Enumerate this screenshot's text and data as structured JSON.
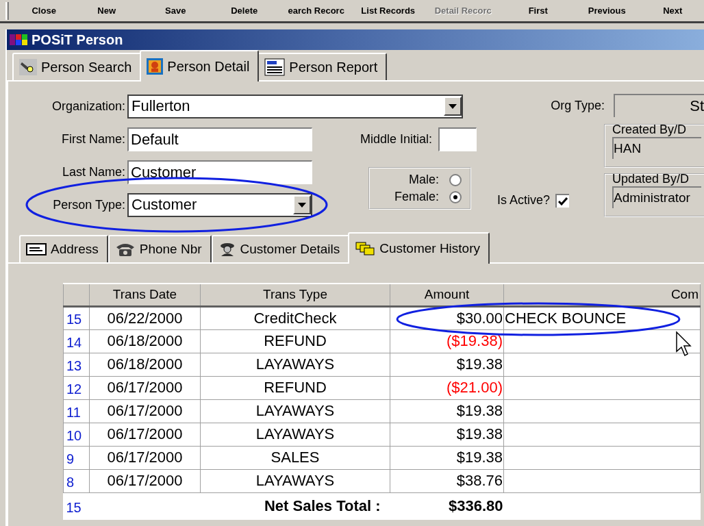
{
  "toolbar": {
    "buttons": [
      {
        "label": "Close",
        "disabled": false
      },
      {
        "label": "New",
        "disabled": false
      },
      {
        "label": "Save",
        "disabled": false
      },
      {
        "label": "Delete",
        "disabled": false
      },
      {
        "label": "earch Recorc",
        "disabled": false
      },
      {
        "label": "List Records",
        "disabled": false
      },
      {
        "label": "Detail Recorc",
        "disabled": true
      },
      {
        "label": "First",
        "disabled": false
      },
      {
        "label": "Previous",
        "disabled": false
      },
      {
        "label": "Next",
        "disabled": false
      }
    ]
  },
  "window": {
    "title": "POSiT Person"
  },
  "tabs": [
    {
      "label": "Person Search",
      "selected": false
    },
    {
      "label": "Person Detail",
      "selected": true
    },
    {
      "label": "Person Report",
      "selected": false
    }
  ],
  "form": {
    "organization": {
      "label": "Organization:",
      "value": "Fullerton"
    },
    "org_type": {
      "label": "Org Type:",
      "value": "St"
    },
    "first_name": {
      "label": "First Name:",
      "value": "Default"
    },
    "middle_initial": {
      "label": "Middle Initial:"
    },
    "last_name": {
      "label": "Last Name:",
      "value": "Customer"
    },
    "person_type": {
      "label": "Person Type:",
      "value": "Customer"
    },
    "gender": [
      {
        "label": "Male:",
        "selected": false
      },
      {
        "label": "Female:",
        "selected": true
      }
    ],
    "is_active": {
      "label": "Is Active?",
      "checked": true
    },
    "created": {
      "legend": "Created By/D",
      "value": "HAN"
    },
    "updated": {
      "legend": "Updated By/D",
      "value": "Administrator"
    }
  },
  "sub_tabs": [
    {
      "label": "Address",
      "selected": false
    },
    {
      "label": "Phone Nbr",
      "selected": false
    },
    {
      "label": "Customer Details",
      "selected": false
    },
    {
      "label": "Customer History",
      "selected": true
    }
  ],
  "history": {
    "columns": [
      "Trans Date",
      "Trans Type",
      "Amount",
      "Com"
    ],
    "rows": [
      {
        "number": "15",
        "date": "06/22/2000",
        "type": "CreditCheck",
        "amount": "$30.00",
        "negative": false,
        "comment": "CHECK BOUNCE"
      },
      {
        "number": "14",
        "date": "06/18/2000",
        "type": "REFUND",
        "amount": "($19.38)",
        "negative": true
      },
      {
        "number": "13",
        "date": "06/18/2000",
        "type": "LAYAWAYS",
        "amount": "$19.38",
        "negative": false
      },
      {
        "number": "12",
        "date": "06/17/2000",
        "type": "REFUND",
        "amount": "($21.00)",
        "negative": true
      },
      {
        "number": "11",
        "date": "06/17/2000",
        "type": "LAYAWAYS",
        "amount": "$19.38",
        "negative": false
      },
      {
        "number": "10",
        "date": "06/17/2000",
        "type": "LAYAWAYS",
        "amount": "$19.38",
        "negative": false
      },
      {
        "number": "9",
        "date": "06/17/2000",
        "type": "SALES",
        "amount": "$19.38",
        "negative": false
      },
      {
        "number": "8",
        "date": "06/17/2000",
        "type": "LAYAWAYS",
        "amount": "$38.76",
        "negative": false
      }
    ],
    "footer": {
      "count": "15",
      "label": "Net Sales Total :",
      "total": "$336.80"
    }
  }
}
